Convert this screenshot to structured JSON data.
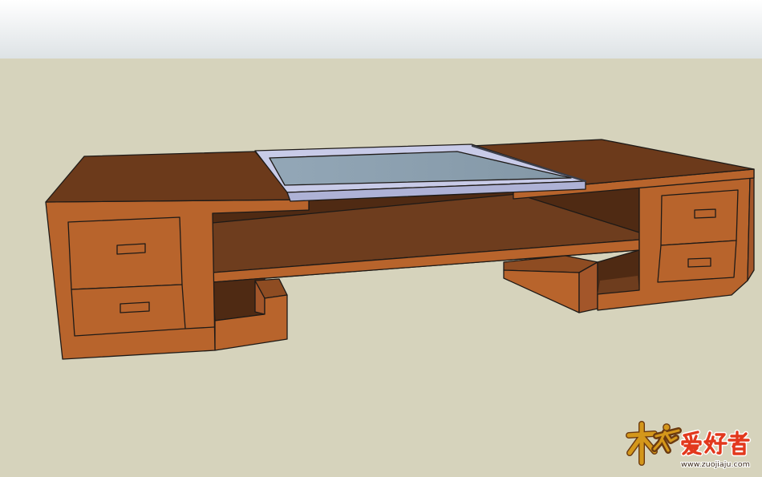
{
  "watermark": {
    "logo_char": "木",
    "logo_text": "爱好者",
    "url": "www.zuojiaju.com"
  },
  "colors": {
    "sky_top": "#ffffff",
    "sky_bottom": "#dde2e5",
    "ground": "#d6d3bc",
    "wood_front": "#b8642c",
    "wood_side": "#a3562a",
    "wood_top": "#6c3a1b",
    "wood_top_light": "#8e4c22",
    "interior": "#4f2a13",
    "shelf_top": "#6e3d1e",
    "glass_frame": "#c8cbe8",
    "glass_frame_edge": "#aeb2d6",
    "glass_left": "#93a7b7",
    "glass_right": "#8397a6",
    "outline": "#1e1a17",
    "logo_red": "#e2381d",
    "logo_gold": "#d4971b",
    "logo_url": "#3a2a1a"
  }
}
